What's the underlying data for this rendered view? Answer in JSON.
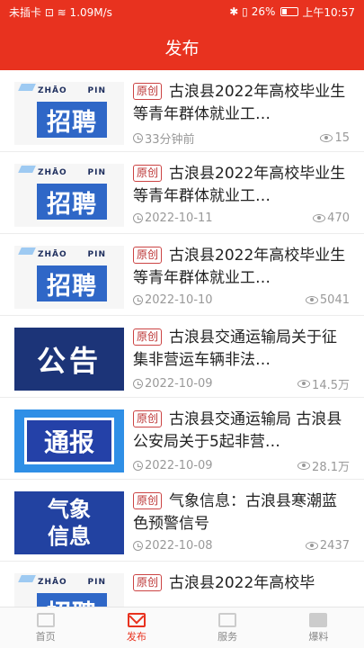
{
  "status_bar": {
    "left": "未插卡 ⊡ ≋ 1.09M/s",
    "right_icons": "✱ ▯",
    "battery_percent": "26%",
    "time": "上午10:57",
    "battery_level": 0.26
  },
  "header": {
    "title": "发布"
  },
  "articles": [
    {
      "thumb": "招聘",
      "thumb_small_left": "ZHĀO",
      "thumb_small_right": "PIN",
      "badge": "原创",
      "title": "古浪县2022年高校毕业生等青年群体就业工…",
      "date": "33分钟前",
      "views": "15"
    },
    {
      "thumb": "招聘",
      "thumb_small_left": "ZHĀO",
      "thumb_small_right": "PIN",
      "badge": "原创",
      "title": "古浪县2022年高校毕业生等青年群体就业工…",
      "date": "2022-10-11",
      "views": "470"
    },
    {
      "thumb": "招聘",
      "thumb_small_left": "ZHĀO",
      "thumb_small_right": "PIN",
      "badge": "原创",
      "title": "古浪县2022年高校毕业生等青年群体就业工…",
      "date": "2022-10-10",
      "views": "5041"
    },
    {
      "thumb": "公告",
      "badge": "原创",
      "title": "古浪县交通运输局关于征集非营运车辆非法…",
      "date": "2022-10-09",
      "views": "14.5万"
    },
    {
      "thumb": "通报",
      "badge": "原创",
      "title": "古浪县交通运输局 古浪县公安局关于5起非营…",
      "date": "2022-10-09",
      "views": "28.1万"
    },
    {
      "thumb_line1": "气象",
      "thumb_line2": "信息",
      "badge": "原创",
      "title": "气象信息：古浪县寒潮蓝色预警信号",
      "date": "2022-10-08",
      "views": "2437"
    },
    {
      "thumb": "招聘",
      "thumb_small_left": "ZHĀO",
      "thumb_small_right": "PIN",
      "badge": "原创",
      "title": "古浪县2022年高校毕",
      "date": "",
      "views": ""
    }
  ],
  "tabbar": {
    "home": "首页",
    "publish": "发布",
    "service": "服务",
    "report": "爆料"
  },
  "colors": {
    "brand": "#e8321f"
  }
}
